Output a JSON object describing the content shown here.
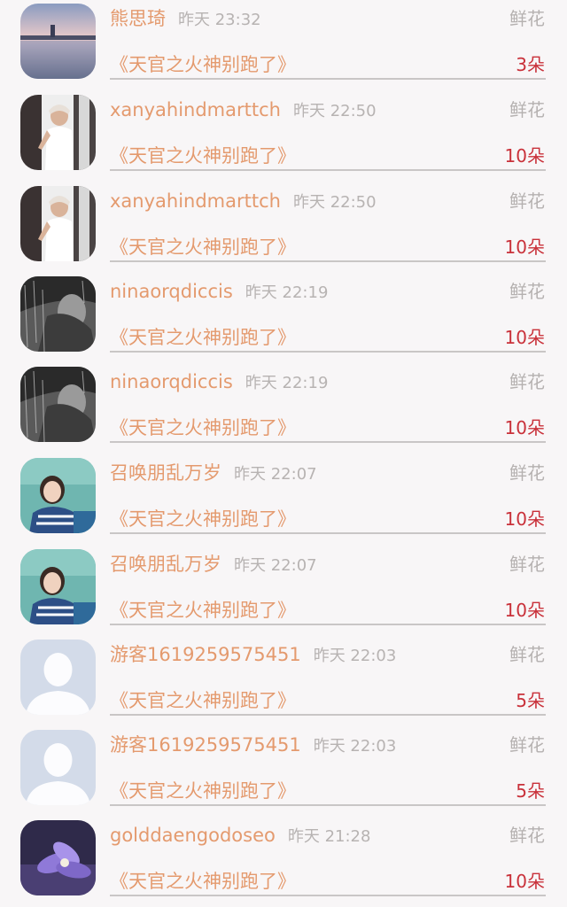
{
  "colors": {
    "name": "#e49a6e",
    "time": "#b7b3b2",
    "gift_type": "#b5b1b0",
    "count": "#c9313a",
    "divider": "#c9c6c6",
    "background": "#f8f6f7"
  },
  "gifts": [
    {
      "name": "熊思琦",
      "time": "昨天 23:32",
      "gift_type": "鲜花",
      "book": "《天官之火神别跑了》",
      "count": "3朵",
      "avatar": "landscape-photo"
    },
    {
      "name": "xanyahindmarttch",
      "time": "昨天 22:50",
      "gift_type": "鲜花",
      "book": "《天官之火神别跑了》",
      "count": "10朵",
      "avatar": "girl-white-dress-photo"
    },
    {
      "name": "xanyahindmarttch",
      "time": "昨天 22:50",
      "gift_type": "鲜花",
      "book": "《天官之火神别跑了》",
      "count": "10朵",
      "avatar": "girl-white-dress-photo"
    },
    {
      "name": "ninaorqdiccis",
      "time": "昨天 22:19",
      "gift_type": "鲜花",
      "book": "《天官之火神别跑了》",
      "count": "10朵",
      "avatar": "bw-rain-photo"
    },
    {
      "name": "ninaorqdiccis",
      "time": "昨天 22:19",
      "gift_type": "鲜花",
      "book": "《天官之火神别跑了》",
      "count": "10朵",
      "avatar": "bw-rain-photo"
    },
    {
      "name": "召唤朋乱万岁",
      "time": "昨天 22:07",
      "gift_type": "鲜花",
      "book": "《天官之火神别跑了》",
      "count": "10朵",
      "avatar": "girl-classroom-photo"
    },
    {
      "name": "召唤朋乱万岁",
      "time": "昨天 22:07",
      "gift_type": "鲜花",
      "book": "《天官之火神别跑了》",
      "count": "10朵",
      "avatar": "girl-classroom-photo"
    },
    {
      "name": "游客1619259575451",
      "time": "昨天 22:03",
      "gift_type": "鲜花",
      "book": "《天官之火神别跑了》",
      "count": "5朵",
      "avatar": "default-user-placeholder"
    },
    {
      "name": "游客1619259575451",
      "time": "昨天 22:03",
      "gift_type": "鲜花",
      "book": "《天官之火神别跑了》",
      "count": "5朵",
      "avatar": "default-user-placeholder"
    },
    {
      "name": "golddaengodoseo",
      "time": "昨天 21:28",
      "gift_type": "鲜花",
      "book": "《天官之火神别跑了》",
      "count": "10朵",
      "avatar": "purple-flower-photo"
    }
  ]
}
